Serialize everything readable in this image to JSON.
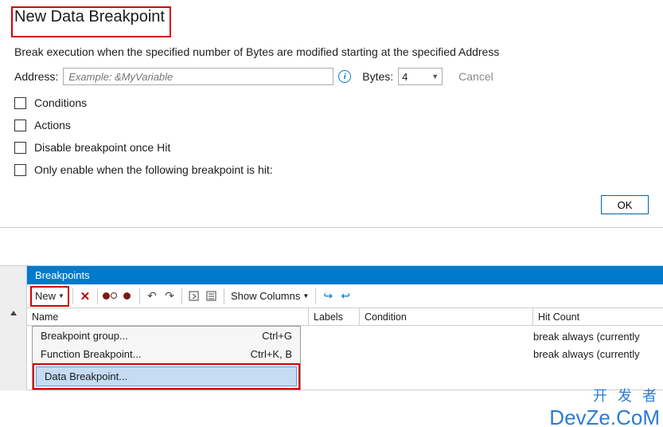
{
  "dialog": {
    "title": "New Data Breakpoint",
    "description": "Break execution when the specified number of Bytes are modified starting at the specified Address",
    "address_label": "Address:",
    "address_placeholder": "Example: &MyVariable",
    "bytes_label": "Bytes:",
    "bytes_value": "4",
    "cancel": "Cancel",
    "checks": {
      "conditions": "Conditions",
      "actions": "Actions",
      "disable_once_hit": "Disable breakpoint once Hit",
      "only_enable_when": "Only enable when the following breakpoint is hit:"
    },
    "ok": "OK"
  },
  "panel": {
    "title": "Breakpoints",
    "toolbar": {
      "new": "New",
      "show_columns": "Show Columns"
    },
    "columns": {
      "name": "Name",
      "labels": "Labels",
      "condition": "Condition",
      "hit_count": "Hit Count"
    },
    "menu": {
      "items": [
        {
          "label": "Breakpoint group...",
          "shortcut": "Ctrl+G"
        },
        {
          "label": "Function Breakpoint...",
          "shortcut": "Ctrl+K, B"
        },
        {
          "label": "Data Breakpoint...",
          "shortcut": ""
        }
      ]
    },
    "rows": [
      {
        "condition": "",
        "hit": "break always (currently "
      },
      {
        "condition": "",
        "hit": "break always (currently "
      }
    ]
  },
  "watermark": {
    "line1": "开 发 者",
    "line2": "DevZe.CoM"
  }
}
